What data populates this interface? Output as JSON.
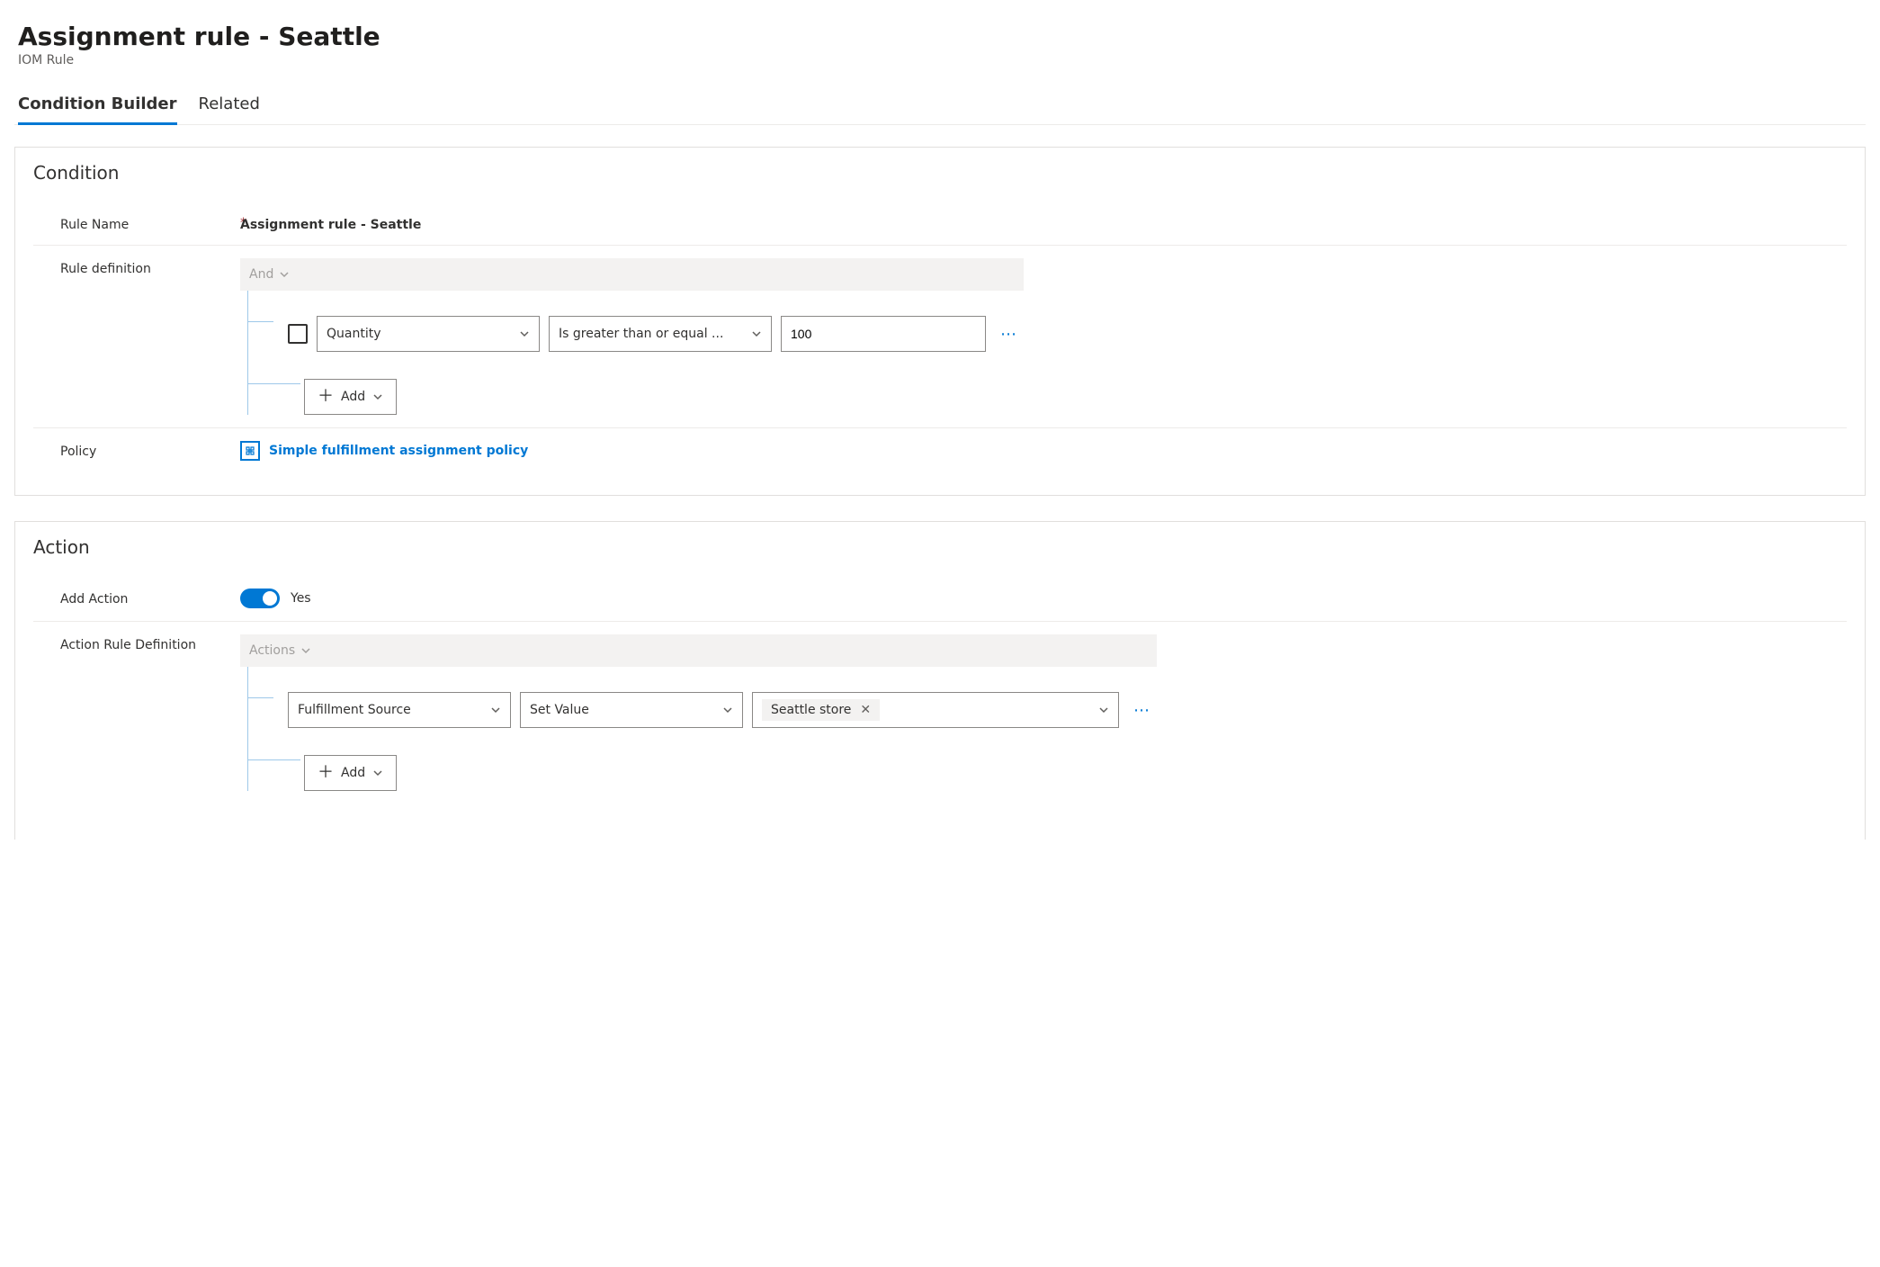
{
  "header": {
    "title": "Assignment rule - Seattle",
    "subtitle": "IOM Rule"
  },
  "tabs": {
    "active": "Condition Builder",
    "items": [
      "Condition Builder",
      "Related"
    ]
  },
  "condition": {
    "section_title": "Condition",
    "rule_name_label": "Rule Name",
    "rule_name_value": "Assignment rule - Seattle",
    "rule_def_label": "Rule definition",
    "group_op": "And",
    "row": {
      "field": "Quantity",
      "operator": "Is greater than or equal ...",
      "value": "100"
    },
    "add_label": "Add",
    "policy_label": "Policy",
    "policy_link": "Simple fulfillment assignment policy"
  },
  "action": {
    "section_title": "Action",
    "add_action_label": "Add Action",
    "add_action_value": "Yes",
    "rule_def_label": "Action Rule Definition",
    "group_op": "Actions",
    "row": {
      "field": "Fulfillment Source",
      "operator": "Set Value",
      "value": "Seattle store"
    },
    "add_label": "Add"
  }
}
